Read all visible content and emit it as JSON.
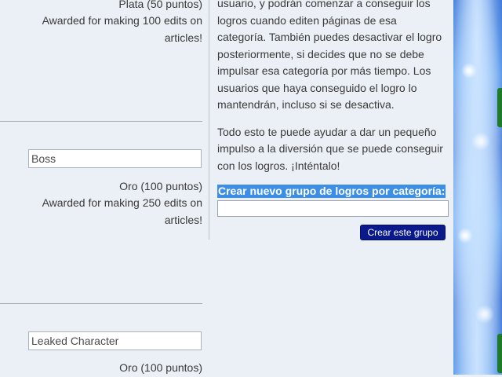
{
  "left_column": {
    "achievements": [
      {
        "name": "",
        "points": "Plata (50 puntos)",
        "description": "Awarded for making 100 edits on articles!"
      },
      {
        "name": "Boss",
        "points": "Oro (100 puntos)",
        "description": "Awarded for making 250 edits on articles!"
      },
      {
        "name": "Leaked Character",
        "points": "Oro (100 puntos)",
        "description": ""
      }
    ]
  },
  "right_column": {
    "paragraph1": "usuario, y podrán comenzar a conseguir los logros cuando editen páginas de esa categoría. También puedes desactivar el logro posteriormente, si decides que no se debe impulsar esa categoría por más tiempo. Los usuarios que haya conseguido el logro lo mantendrán, incluso si se desactiva.",
    "paragraph2": "Todo esto te puede ayudar a dar un pequeño impulso a la diversión que se puede conseguir con los logros. ¡Inténtalo!",
    "create_label": "Crear nuevo grupo de logros por categoría:",
    "create_input_value": "",
    "create_button": "Crear este grupo"
  },
  "colors": {
    "page_bg": "#eaf0f5",
    "button_bg": "#0a1a8c",
    "highlight_bg": "#3d8fe6"
  }
}
